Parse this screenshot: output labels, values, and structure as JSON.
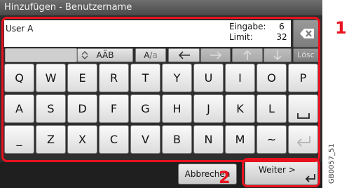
{
  "window": {
    "title": "Hinzufügen - Benutzername"
  },
  "input": {
    "value": "User A"
  },
  "counter": {
    "entry_label": "Eingabe:",
    "entry_value": "6",
    "limit_label": "Limit:",
    "limit_value": "32"
  },
  "toolbar": {
    "charset_label": "AÄB",
    "case_label_upper": "A",
    "case_label_lower": "a",
    "delete_label": "Lösc"
  },
  "keyboard": {
    "row1": [
      "Q",
      "W",
      "E",
      "R",
      "T",
      "Y",
      "U",
      "I",
      "O",
      "P"
    ],
    "row2": [
      "A",
      "S",
      "D",
      "F",
      "G",
      "H",
      "J",
      "K",
      "L"
    ],
    "row3": [
      "_",
      "Z",
      "X",
      "C",
      "V",
      "B",
      "N",
      "M",
      "~"
    ]
  },
  "footer": {
    "cancel_label": "Abbrechen",
    "next_label": "Weiter >"
  },
  "annotations": {
    "callout_1": "1",
    "callout_2": "2"
  },
  "figure": {
    "code": "GB0057_51"
  },
  "colors": {
    "highlight": "#e8121f",
    "panel": "#2e2e2e"
  }
}
